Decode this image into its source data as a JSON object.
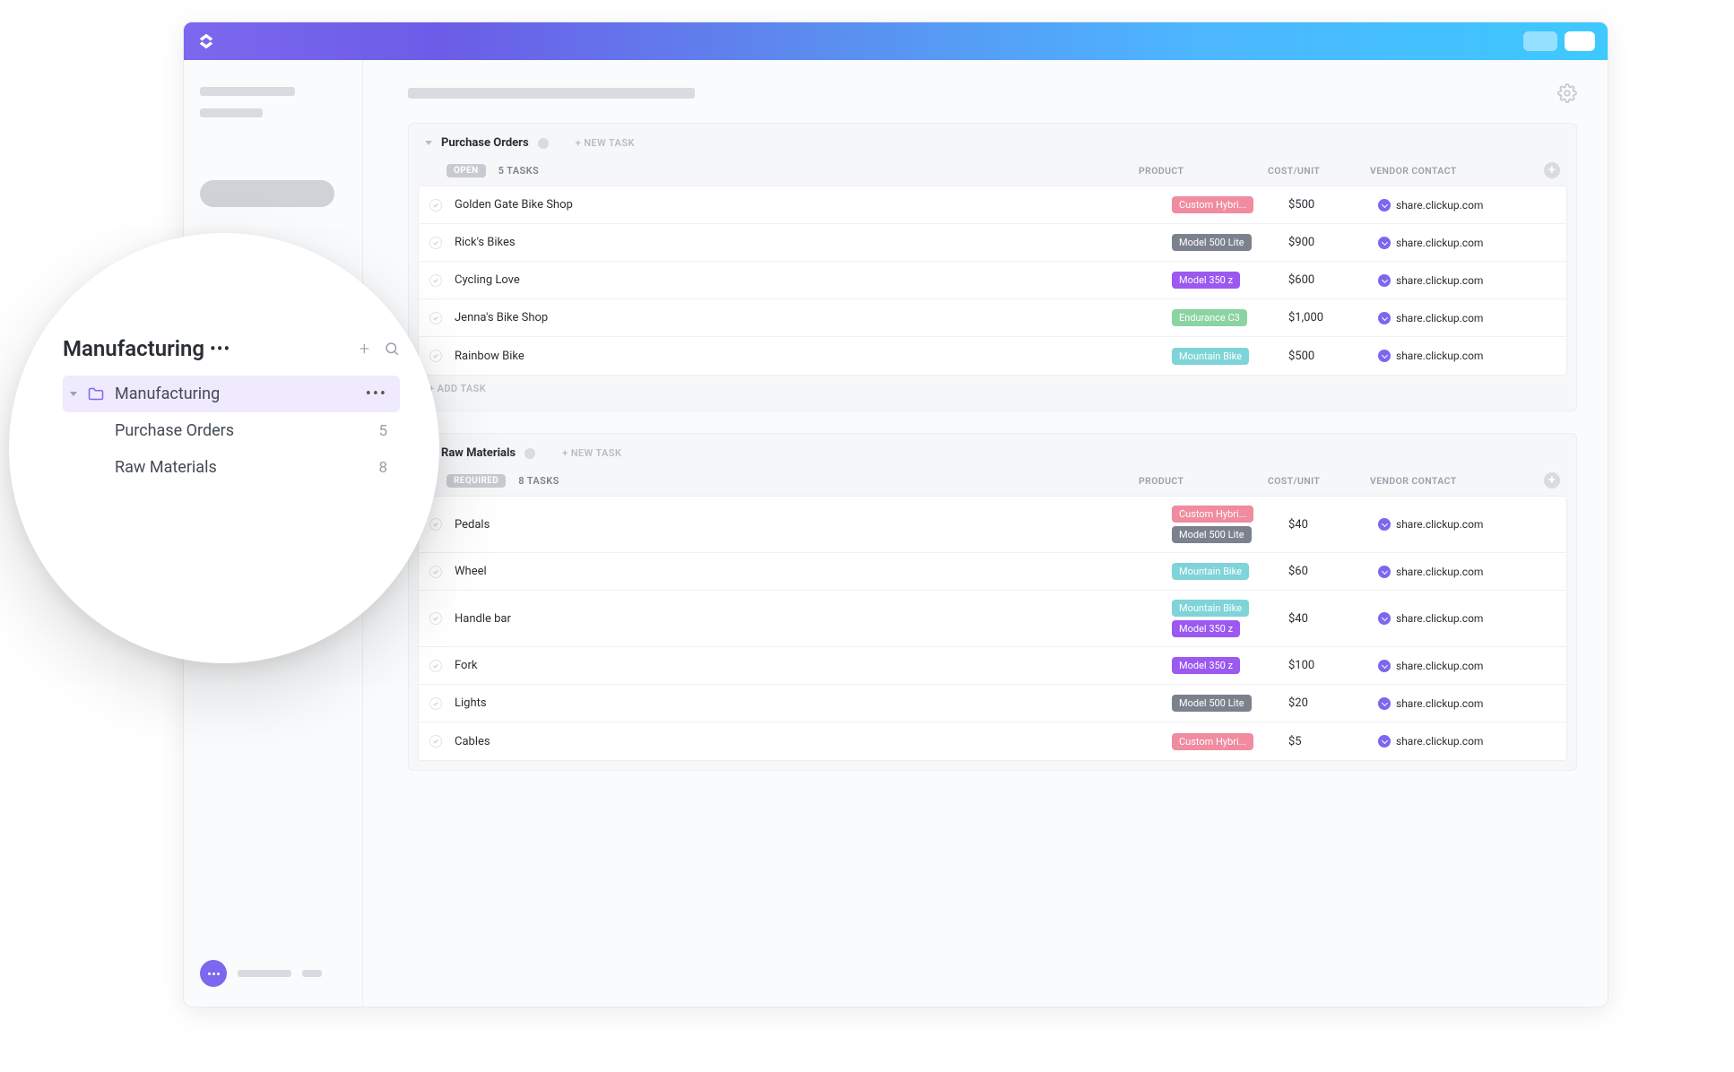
{
  "colors": {
    "tag_pink": "#f08ba0",
    "tag_gray": "#7c828d",
    "tag_purple": "#9b59f0",
    "tag_green": "#8bd4a2",
    "tag_teal": "#7fd4d9"
  },
  "groups": [
    {
      "title": "Purchase Orders",
      "new_task": "+ NEW TASK",
      "status_label": "OPEN",
      "status_class": "status-open",
      "count_label": "5 TASKS",
      "columns": {
        "product": "PRODUCT",
        "cost": "COST/UNIT",
        "vendor": "VENDOR CONTACT"
      },
      "rows": [
        {
          "name": "Golden Gate Bike Shop",
          "tags": [
            {
              "label": "Custom Hybri...",
              "color": "tag_pink"
            }
          ],
          "cost": "$500",
          "vendor": "share.clickup.com"
        },
        {
          "name": "Rick's Bikes",
          "tags": [
            {
              "label": "Model 500 Lite",
              "color": "tag_gray"
            }
          ],
          "cost": "$900",
          "vendor": "share.clickup.com"
        },
        {
          "name": "Cycling Love",
          "tags": [
            {
              "label": "Model 350 z",
              "color": "tag_purple"
            }
          ],
          "cost": "$600",
          "vendor": "share.clickup.com"
        },
        {
          "name": "Jenna's Bike Shop",
          "tags": [
            {
              "label": "Endurance C3",
              "color": "tag_green"
            }
          ],
          "cost": "$1,000",
          "vendor": "share.clickup.com"
        },
        {
          "name": "Rainbow Bike",
          "tags": [
            {
              "label": "Mountain Bike",
              "color": "tag_teal"
            }
          ],
          "cost": "$500",
          "vendor": "share.clickup.com"
        }
      ],
      "add_task": "+ ADD TASK"
    },
    {
      "title": "Raw Materials",
      "new_task": "+ NEW TASK",
      "status_label": "REQUIRED",
      "status_class": "status-required",
      "count_label": "8 TASKS",
      "columns": {
        "product": "PRODUCT",
        "cost": "COST/UNIT",
        "vendor": "VENDOR CONTACT"
      },
      "rows": [
        {
          "name": "Pedals",
          "tags": [
            {
              "label": "Custom Hybri...",
              "color": "tag_pink"
            },
            {
              "label": "Model 500 Lite",
              "color": "tag_gray"
            }
          ],
          "cost": "$40",
          "vendor": "share.clickup.com"
        },
        {
          "name": "Wheel",
          "tags": [
            {
              "label": "Mountain Bike",
              "color": "tag_teal"
            }
          ],
          "cost": "$60",
          "vendor": "share.clickup.com"
        },
        {
          "name": "Handle bar",
          "tags": [
            {
              "label": "Mountain Bike",
              "color": "tag_teal"
            },
            {
              "label": "Model 350 z",
              "color": "tag_purple"
            }
          ],
          "cost": "$40",
          "vendor": "share.clickup.com"
        },
        {
          "name": "Fork",
          "tags": [
            {
              "label": "Model 350 z",
              "color": "tag_purple"
            }
          ],
          "cost": "$100",
          "vendor": "share.clickup.com"
        },
        {
          "name": "Lights",
          "tags": [
            {
              "label": "Model 500 Lite",
              "color": "tag_gray"
            }
          ],
          "cost": "$20",
          "vendor": "share.clickup.com"
        },
        {
          "name": "Cables",
          "tags": [
            {
              "label": "Custom Hybri...",
              "color": "tag_pink"
            }
          ],
          "cost": "$5",
          "vendor": "share.clickup.com"
        }
      ],
      "add_task": ""
    }
  ],
  "magnifier": {
    "space_title": "Manufacturing",
    "folder_label": "Manufacturing",
    "lists": [
      {
        "label": "Purchase Orders",
        "count": "5"
      },
      {
        "label": "Raw Materials",
        "count": "8"
      }
    ]
  }
}
